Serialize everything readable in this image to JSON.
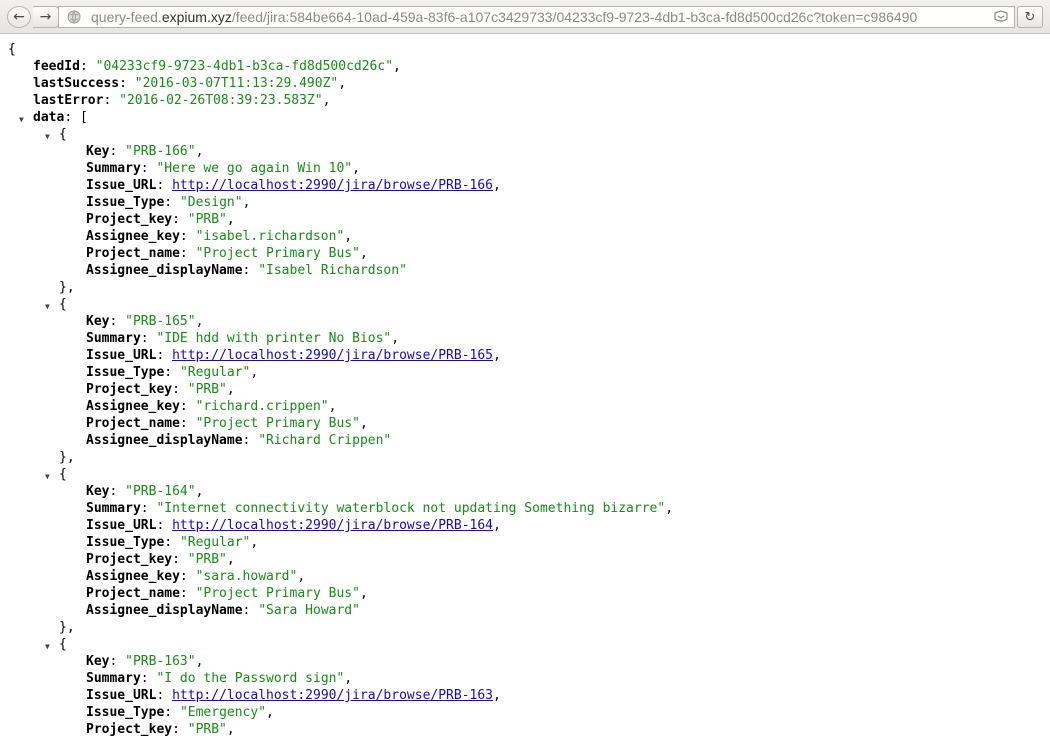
{
  "browser": {
    "url_prefix": "query-feed.",
    "url_host": "expium.xyz",
    "url_path": "/feed/jira:584be664-10ad-459a-83f6-a107c3429733/04233cf9-9723-4db1-b3ca-fd8d500cd26c?token=c986490"
  },
  "json": {
    "open_brace": "{",
    "feedId": {
      "key": "feedId",
      "value": "\"04233cf9-9723-4db1-b3ca-fd8d500cd26c\""
    },
    "lastSuccess": {
      "key": "lastSuccess",
      "value": "\"2016-03-07T11:13:29.490Z\""
    },
    "lastError": {
      "key": "lastError",
      "value": "\"2016-02-26T08:39:23.583Z\""
    },
    "data_key": "data",
    "data_open": "[",
    "field_labels": [
      "Key",
      "Summary",
      "Issue_URL",
      "Issue_Type",
      "Project_key",
      "Assignee_key",
      "Project_name",
      "Assignee_displayName"
    ],
    "items": [
      {
        "Key": "\"PRB-166\"",
        "Summary": "\"Here we go again Win 10\"",
        "Issue_URL": "http://localhost:2990/jira/browse/PRB-166",
        "Issue_Type": "\"Design\"",
        "Project_key": "\"PRB\"",
        "Assignee_key": "\"isabel.richardson\"",
        "Project_name": "\"Project Primary Bus\"",
        "Assignee_displayName": "\"Isabel Richardson\""
      },
      {
        "Key": "\"PRB-165\"",
        "Summary": "\"IDE hdd with printer No Bios\"",
        "Issue_URL": "http://localhost:2990/jira/browse/PRB-165",
        "Issue_Type": "\"Regular\"",
        "Project_key": "\"PRB\"",
        "Assignee_key": "\"richard.crippen\"",
        "Project_name": "\"Project Primary Bus\"",
        "Assignee_displayName": "\"Richard Crippen\""
      },
      {
        "Key": "\"PRB-164\"",
        "Summary": "\"Internet connectivity waterblock not updating Something bizarre\"",
        "Issue_URL": "http://localhost:2990/jira/browse/PRB-164",
        "Issue_Type": "\"Regular\"",
        "Project_key": "\"PRB\"",
        "Assignee_key": "\"sara.howard\"",
        "Project_name": "\"Project Primary Bus\"",
        "Assignee_displayName": "\"Sara Howard\""
      },
      {
        "Key": "\"PRB-163\"",
        "Summary": "\"I do the Password sign\"",
        "Issue_URL": "http://localhost:2990/jira/browse/PRB-163",
        "Issue_Type": "\"Emergency\"",
        "Project_key": "\"PRB\""
      }
    ]
  },
  "colors": {
    "string": "#1a8a1a",
    "link": "#1a0dab",
    "key": "#000000"
  },
  "icons": [
    "back-arrow-icon",
    "forward-arrow-icon",
    "globe-icon",
    "reader-mode-icon",
    "reload-icon",
    "collapse-triangle-icon"
  ]
}
